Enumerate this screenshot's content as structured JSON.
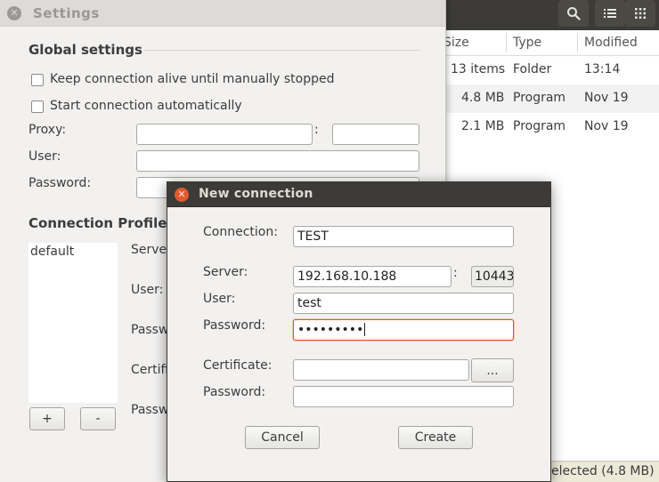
{
  "file_manager": {
    "columns": {
      "size": "Size",
      "type": "Type",
      "modified": "Modified"
    },
    "rows": [
      {
        "size": "13 items",
        "type": "Folder",
        "modified": "13:14"
      },
      {
        "size": "4.8 MB",
        "type": "Program",
        "modified": "Nov 19"
      },
      {
        "size": "2.1 MB",
        "type": "Program",
        "modified": "Nov 19"
      }
    ],
    "status": "elected  (4.8 MB)"
  },
  "settings": {
    "title": "Settings",
    "global_title": "Global settings",
    "keep_alive_label": "Keep connection alive until manually stopped",
    "auto_start_label": "Start connection automatically",
    "proxy_label": "Proxy:",
    "proxy_colon": ":",
    "user_label": "User:",
    "password_label": "Password:",
    "profiles_title": "Connection Profiles",
    "profiles": [
      "default"
    ],
    "server_label": "Server",
    "profile_user_label": "User:",
    "profile_password_label": "Passw",
    "certificate_label": "Certifi",
    "cert_password_label": "Passw",
    "add_label": "+",
    "remove_label": "-"
  },
  "dialog": {
    "title": "New connection",
    "connection_label": "Connection:",
    "connection_value": "TEST",
    "server_label": "Server:",
    "server_value": "192.168.10.188",
    "port_colon": ":",
    "port_value": "10443",
    "user_label": "User:",
    "user_value": "test",
    "password_label": "Password:",
    "password_value": "•••••••••",
    "certificate_label": "Certificate:",
    "certificate_value": "",
    "browse_label": "...",
    "cert_password_label": "Password:",
    "cert_password_value": "",
    "cancel_label": "Cancel",
    "create_label": "Create"
  },
  "colors": {
    "dialog_titlebar": "#3c3b37",
    "close_button": "#e25a2c",
    "focus_border": "#e0542a"
  },
  "icons": [
    "search-icon",
    "list-view-icon",
    "grid-view-icon",
    "close-icon"
  ]
}
